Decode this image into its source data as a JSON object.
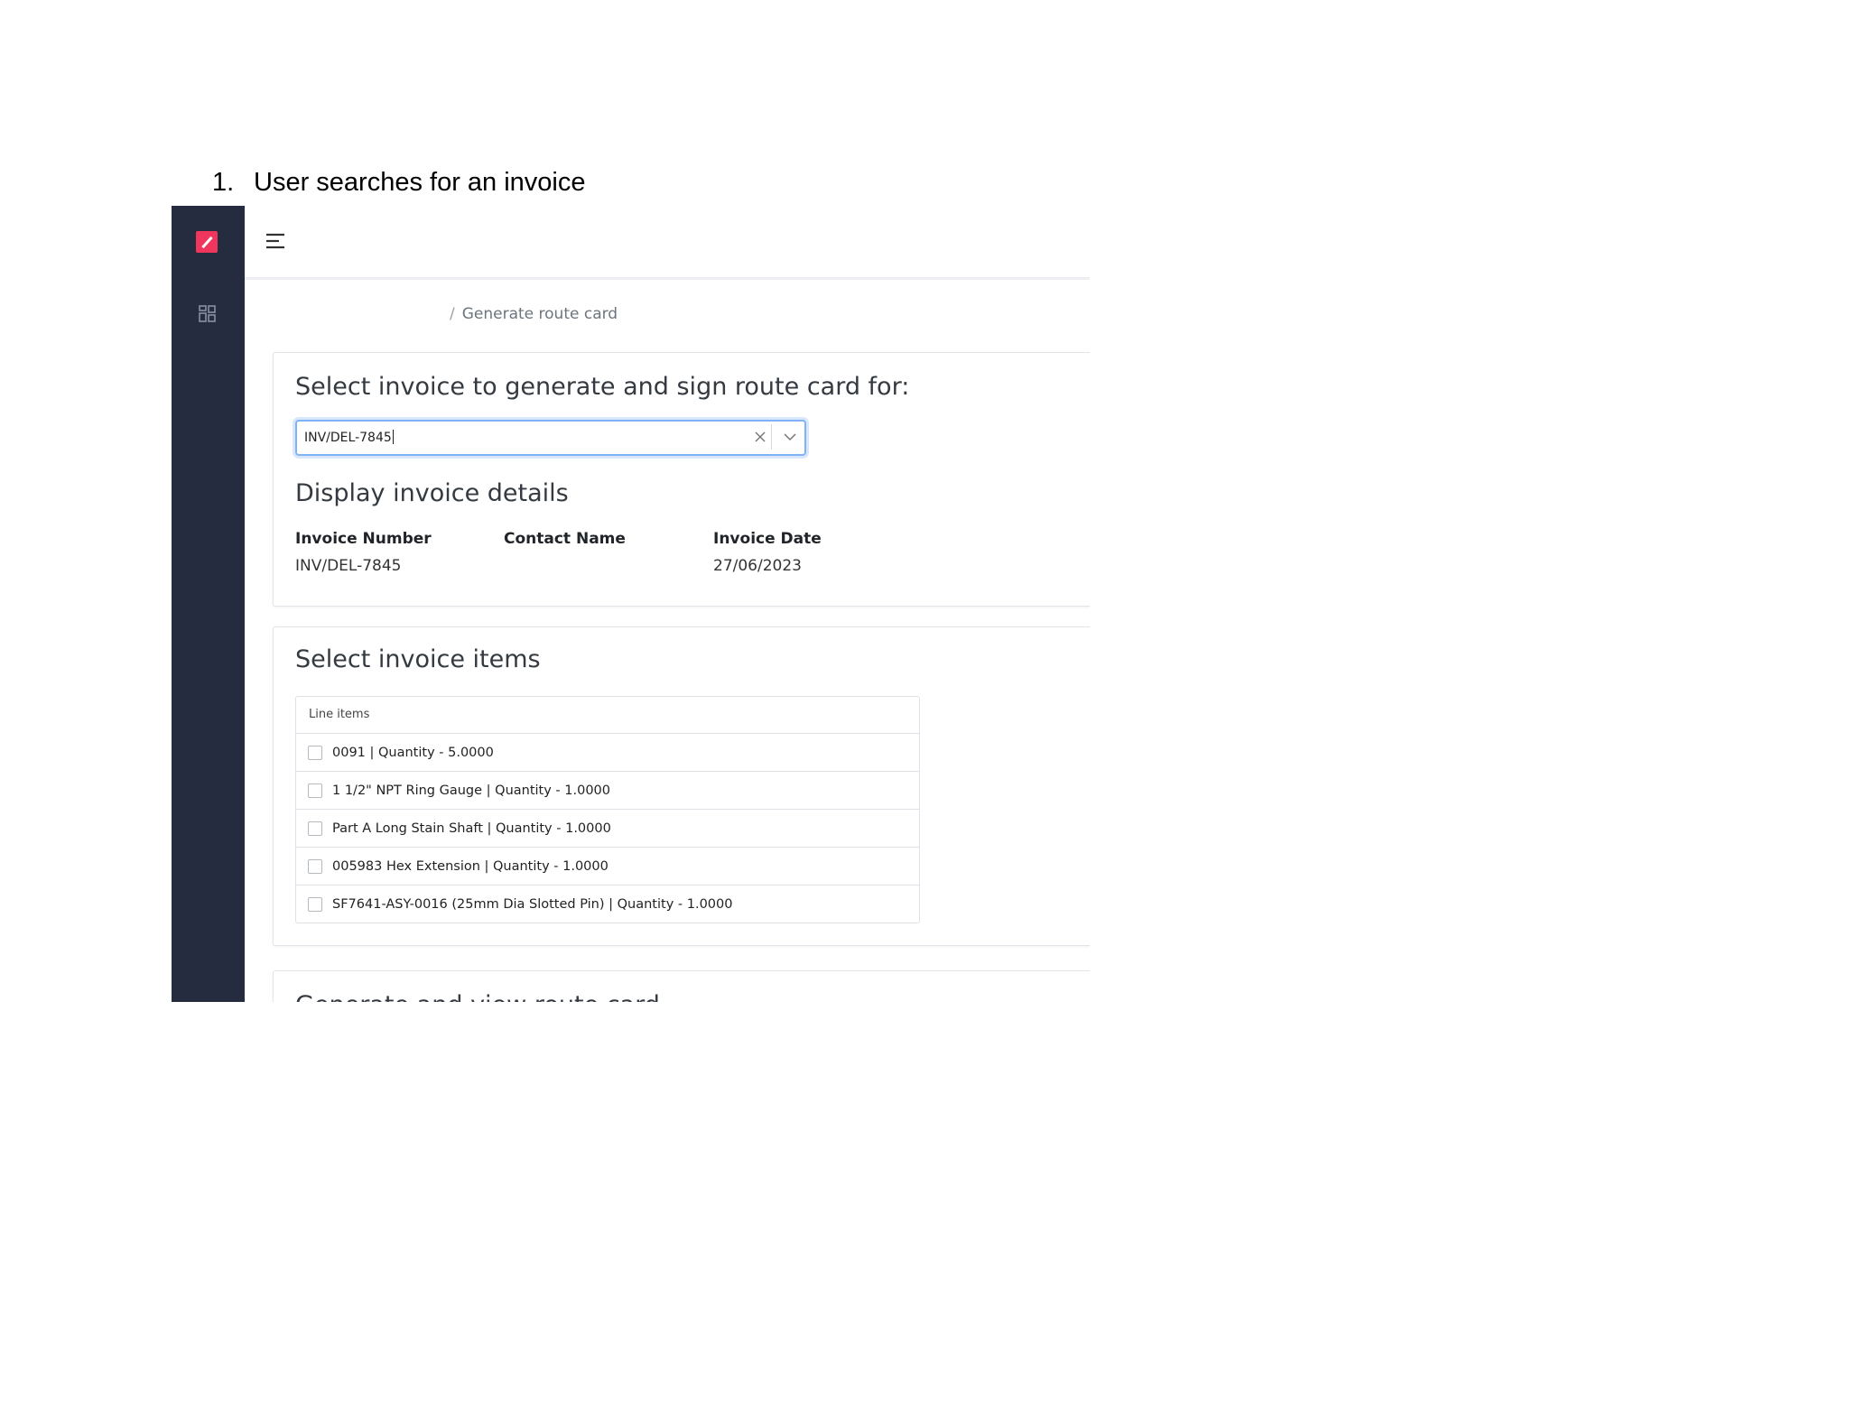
{
  "caption": {
    "number": "1.",
    "text": "User searches for an invoice"
  },
  "colors": {
    "sidebar": "#262c40",
    "logo": "#f0365c",
    "focus_border": "#80b3f5"
  },
  "sidebar": {
    "logo_icon": "brand-logo-icon",
    "nav_icon": "dashboard-icon"
  },
  "topbar": {
    "menu_icon": "hamburger-menu-icon"
  },
  "breadcrumb": {
    "separator": "/",
    "current": "Generate route card"
  },
  "invoice_select": {
    "title": "Select invoice to generate and sign route card for:",
    "value": "INV/DEL-7845",
    "clear_icon": "close-icon",
    "dropdown_icon": "chevron-down-icon"
  },
  "invoice_details": {
    "title": "Display invoice details",
    "columns": [
      {
        "label": "Invoice Number",
        "value": "INV/DEL-7845"
      },
      {
        "label": "Contact Name",
        "value": ""
      },
      {
        "label": "Invoice Date",
        "value": "27/06/2023"
      }
    ]
  },
  "invoice_items": {
    "title": "Select invoice items",
    "header": "Line items",
    "items": [
      {
        "label": "0091 | Quantity - 5.0000",
        "checked": false
      },
      {
        "label": "1 1/2\" NPT Ring Gauge | Quantity - 1.0000",
        "checked": false
      },
      {
        "label": "Part A Long Stain Shaft | Quantity - 1.0000",
        "checked": false
      },
      {
        "label": "005983 Hex Extension | Quantity - 1.0000",
        "checked": false
      },
      {
        "label": "SF7641-ASY-0016 (25mm Dia Slotted Pin) | Quantity - 1.0000",
        "checked": false
      }
    ]
  },
  "route_card": {
    "title": "Generate and view route card"
  }
}
